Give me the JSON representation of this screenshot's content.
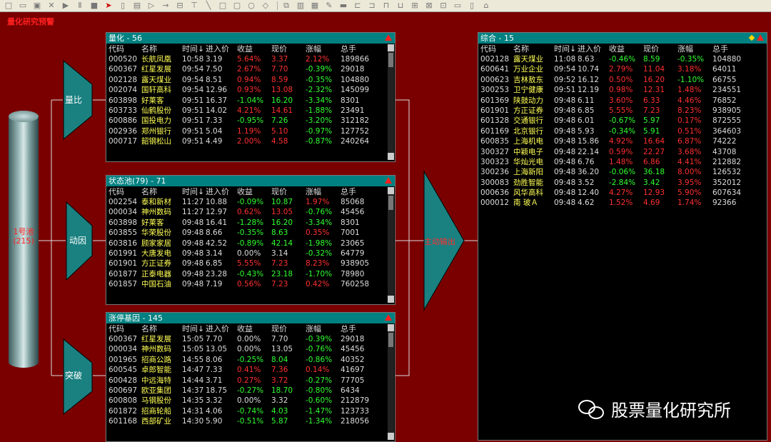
{
  "app_title": "量化研究预警",
  "left_store": {
    "label": "1号池",
    "count": "(215)"
  },
  "flow_labels": {
    "liangbi": "量比",
    "dongyin": "动因",
    "tupo": "突破",
    "output": "主动输出"
  },
  "columns": [
    "代码",
    "名称",
    "时间↓",
    "进入价",
    "收益",
    "现价",
    "涨幅",
    "总手"
  ],
  "panels": [
    {
      "id": "liangbi",
      "title": "量化 - 56",
      "rows": [
        [
          "000520",
          "长航凤凰",
          "10:58",
          "3.19",
          "5.64%",
          "3.37",
          "2.12%",
          "189866",
          "up",
          "up"
        ],
        [
          "600367",
          "红星发展",
          "09:54",
          "7.50",
          "2.67%",
          "7.70",
          "-0.39%",
          "29018",
          "up",
          "down"
        ],
        [
          "002128",
          "露天煤业",
          "09:54",
          "8.51",
          "0.94%",
          "8.59",
          "-0.35%",
          "104880",
          "up",
          "down"
        ],
        [
          "002074",
          "国轩高科",
          "09:54",
          "12.96",
          "0.93%",
          "13.08",
          "-2.32%",
          "145099",
          "up",
          "down"
        ],
        [
          "603898",
          "好莱客",
          "09:51",
          "16.37",
          "-1.04%",
          "16.20",
          "-3.34%",
          "8301",
          "down",
          "down"
        ],
        [
          "603733",
          "仙鹤股份",
          "09:51",
          "14.02",
          "4.21%",
          "14.61",
          "-1.88%",
          "23491",
          "up",
          "down"
        ],
        [
          "600886",
          "国投电力",
          "09:51",
          "7.33",
          "-0.95%",
          "7.26",
          "-3.20%",
          "312182",
          "down",
          "down"
        ],
        [
          "002936",
          "郑州银行",
          "09:51",
          "5.04",
          "1.19%",
          "5.10",
          "-0.97%",
          "127752",
          "up",
          "down"
        ],
        [
          "000717",
          "韶钢松山",
          "09:51",
          "4.49",
          "2.00%",
          "4.58",
          "-0.87%",
          "240264",
          "up",
          "down"
        ]
      ]
    },
    {
      "id": "zhuangtai",
      "title": "状态池(79) - 71",
      "rows": [
        [
          "002254",
          "泰和新材",
          "11:27",
          "10.88",
          "-0.09%",
          "10.87",
          "1.97%",
          "85068",
          "down",
          "up"
        ],
        [
          "000034",
          "神州数码",
          "11:27",
          "12.97",
          "0.62%",
          "13.05",
          "-0.76%",
          "45456",
          "up",
          "down"
        ],
        [
          "603898",
          "好莱客",
          "09:48",
          "16.41",
          "-1.28%",
          "16.20",
          "-3.34%",
          "8301",
          "down",
          "down"
        ],
        [
          "603855",
          "华荣股份",
          "09:48",
          "8.66",
          "-0.35%",
          "8.63",
          "0.35%",
          "7001",
          "down",
          "up"
        ],
        [
          "603816",
          "顾家家居",
          "09:48",
          "42.52",
          "-0.89%",
          "42.14",
          "-1.98%",
          "23065",
          "down",
          "down"
        ],
        [
          "601991",
          "大唐发电",
          "09:48",
          "3.14",
          "0.00%",
          "3.14",
          "-0.32%",
          "64779",
          "flat",
          "down"
        ],
        [
          "601901",
          "方正证券",
          "09:48",
          "6.85",
          "5.55%",
          "7.23",
          "8.23%",
          "938905",
          "up",
          "up"
        ],
        [
          "601877",
          "正泰电器",
          "09:48",
          "23.28",
          "-0.43%",
          "23.18",
          "-1.70%",
          "78980",
          "down",
          "down"
        ],
        [
          "601857",
          "中国石油",
          "09:48",
          "7.19",
          "0.56%",
          "7.23",
          "0.42%",
          "760258",
          "up",
          "up"
        ]
      ]
    },
    {
      "id": "zhangting",
      "title": "涨停基因 - 145",
      "rows": [
        [
          "600367",
          "红星发展",
          "15:05",
          "7.70",
          "0.00%",
          "7.70",
          "-0.39%",
          "29018",
          "flat",
          "down"
        ],
        [
          "000034",
          "神州数码",
          "15:05",
          "13.05",
          "0.00%",
          "13.05",
          "-0.76%",
          "45456",
          "flat",
          "down"
        ],
        [
          "001965",
          "招商公路",
          "14:55",
          "8.06",
          "-0.25%",
          "8.04",
          "-0.86%",
          "40352",
          "down",
          "down"
        ],
        [
          "600545",
          "卓郎智能",
          "14:47",
          "7.33",
          "0.41%",
          "7.36",
          "0.14%",
          "41697",
          "up",
          "up"
        ],
        [
          "600428",
          "中远海特",
          "14:44",
          "3.71",
          "0.27%",
          "3.72",
          "-0.27%",
          "77705",
          "up",
          "down"
        ],
        [
          "600697",
          "欧亚集团",
          "14:37",
          "18.75",
          "-0.27%",
          "18.70",
          "-0.80%",
          "6434",
          "down",
          "down"
        ],
        [
          "600808",
          "马钢股份",
          "14:35",
          "3.32",
          "0.00%",
          "3.32",
          "-0.60%",
          "212879",
          "flat",
          "down"
        ],
        [
          "601872",
          "招商轮船",
          "14:31",
          "4.06",
          "-0.74%",
          "4.03",
          "-1.47%",
          "123733",
          "down",
          "down"
        ],
        [
          "601168",
          "西部矿业",
          "14:30",
          "5.90",
          "-0.51%",
          "5.87",
          "-1.34%",
          "218056",
          "down",
          "down"
        ]
      ]
    },
    {
      "id": "zonghe",
      "title": "综合 - 15",
      "rows": [
        [
          "002128",
          "露天煤业",
          "11:08",
          "8.63",
          "-0.46%",
          "8.59",
          "-0.35%",
          "104880",
          "down",
          "down"
        ],
        [
          "600641",
          "万业企业",
          "09:54",
          "10.74",
          "2.79%",
          "11.04",
          "3.18%",
          "64011",
          "up",
          "up"
        ],
        [
          "000623",
          "吉林敖东",
          "09:52",
          "16.12",
          "0.50%",
          "16.20",
          "-1.10%",
          "66755",
          "up",
          "down"
        ],
        [
          "300253",
          "卫宁健康",
          "09:51",
          "12.19",
          "0.98%",
          "12.31",
          "1.48%",
          "234551",
          "up",
          "up"
        ],
        [
          "601369",
          "陕鼓动力",
          "09:48",
          "6.11",
          "3.60%",
          "6.33",
          "4.46%",
          "76852",
          "up",
          "up"
        ],
        [
          "601901",
          "方正证券",
          "09:48",
          "6.85",
          "5.55%",
          "7.23",
          "8.23%",
          "938905",
          "up",
          "up"
        ],
        [
          "601328",
          "交通银行",
          "09:48",
          "6.01",
          "-0.67%",
          "5.97",
          "0.17%",
          "872555",
          "down",
          "up"
        ],
        [
          "601169",
          "北京银行",
          "09:48",
          "5.93",
          "-0.34%",
          "5.91",
          "0.51%",
          "364603",
          "down",
          "up"
        ],
        [
          "600835",
          "上海机电",
          "09:48",
          "15.86",
          "4.92%",
          "16.64",
          "6.87%",
          "74222",
          "up",
          "up"
        ],
        [
          "300327",
          "中颖电子",
          "09:48",
          "22.14",
          "0.59%",
          "22.27",
          "3.68%",
          "43708",
          "up",
          "up"
        ],
        [
          "300323",
          "华灿光电",
          "09:48",
          "6.76",
          "1.48%",
          "6.86",
          "4.41%",
          "212882",
          "up",
          "up"
        ],
        [
          "300236",
          "上海新阳",
          "09:48",
          "36.20",
          "-0.06%",
          "36.18",
          "8.00%",
          "126532",
          "down",
          "up"
        ],
        [
          "300083",
          "劲胜智能",
          "09:48",
          "3.52",
          "-2.84%",
          "3.42",
          "3.95%",
          "352012",
          "down",
          "up"
        ],
        [
          "000636",
          "风华高科",
          "09:48",
          "12.40",
          "4.27%",
          "12.93",
          "5.90%",
          "607634",
          "up",
          "up"
        ],
        [
          "000012",
          "南 玻Ａ",
          "09:48",
          "4.62",
          "1.52%",
          "4.69",
          "1.74%",
          "92366",
          "up",
          "up"
        ]
      ]
    }
  ],
  "watermark": "股票量化研究所",
  "colors": {
    "up": "#ff3030",
    "down": "#30ff30",
    "header": "#008080",
    "bg": "#7a0000"
  }
}
